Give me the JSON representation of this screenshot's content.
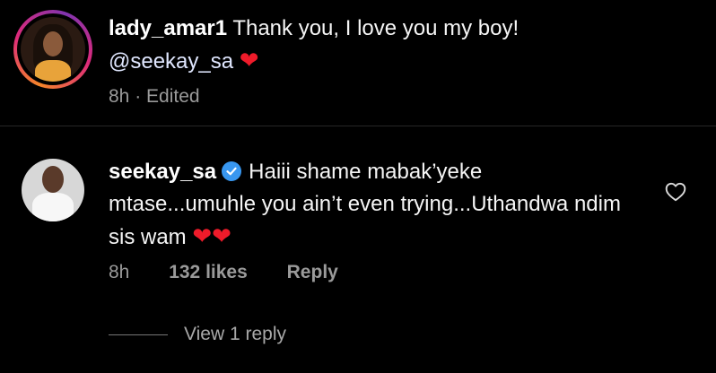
{
  "comments": [
    {
      "username": "lady_amar1",
      "text": "Thank you, I love you my boy!",
      "mention": "@seekay_sa",
      "emoji": "❤",
      "time": "8h",
      "edited": "Edited",
      "separator": "·"
    },
    {
      "username": "seekay_sa",
      "verified": true,
      "text": "Haiii shame mabak’yeke mtase...umuhle you ain’t even trying...Uthandwa ndim sis wam",
      "emoji": "❤❤",
      "time": "8h",
      "likes": "132 likes",
      "reply_label": "Reply",
      "view_replies": "View 1 reply"
    }
  ],
  "colors": {
    "background": "#000000",
    "text": "#f5f5f5",
    "meta": "#9a9a9a",
    "verified": "#3897f0",
    "heart": "#ef1b2a"
  }
}
